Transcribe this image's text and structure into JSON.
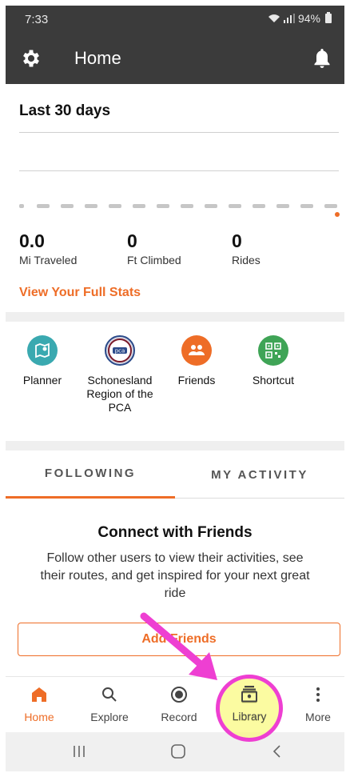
{
  "status_bar": {
    "time": "7:33",
    "battery": "94%"
  },
  "app_bar": {
    "title": "Home"
  },
  "stats": {
    "section_title": "Last 30 days",
    "items": [
      {
        "value": "0.0",
        "label": "Mi Traveled"
      },
      {
        "value": "0",
        "label": "Ft Climbed"
      },
      {
        "value": "0",
        "label": "Rides"
      }
    ],
    "link": "View Your Full Stats"
  },
  "shortcuts": [
    {
      "label": "Planner",
      "icon": "map-pin-icon",
      "color": "#3aa9b0"
    },
    {
      "label": "Schonesland Region of the PCA",
      "icon": "club-logo",
      "color": "#2a4a8a"
    },
    {
      "label": "Friends",
      "icon": "people-icon",
      "color": "#ee6d27"
    },
    {
      "label": "Shortcut",
      "icon": "qr-code-icon",
      "color": "#3fa456"
    }
  ],
  "tabs": [
    {
      "label": "FOLLOWING",
      "active": true
    },
    {
      "label": "MY ACTIVITY",
      "active": false
    }
  ],
  "connect": {
    "title": "Connect with Friends",
    "body": "Follow other users to view their activities, see their routes, and get inspired for your next great ride",
    "button": "Add Friends"
  },
  "bottom_nav": [
    {
      "label": "Home",
      "icon": "home-icon",
      "active": true
    },
    {
      "label": "Explore",
      "icon": "search-icon",
      "active": false
    },
    {
      "label": "Record",
      "icon": "record-icon",
      "active": false
    },
    {
      "label": "Library",
      "icon": "library-icon",
      "active": false
    },
    {
      "label": "More",
      "icon": "more-vertical-icon",
      "active": false
    }
  ],
  "colors": {
    "accent": "#ee6d27",
    "header": "#3b3b3b",
    "annotation": "#ee3fd2"
  }
}
